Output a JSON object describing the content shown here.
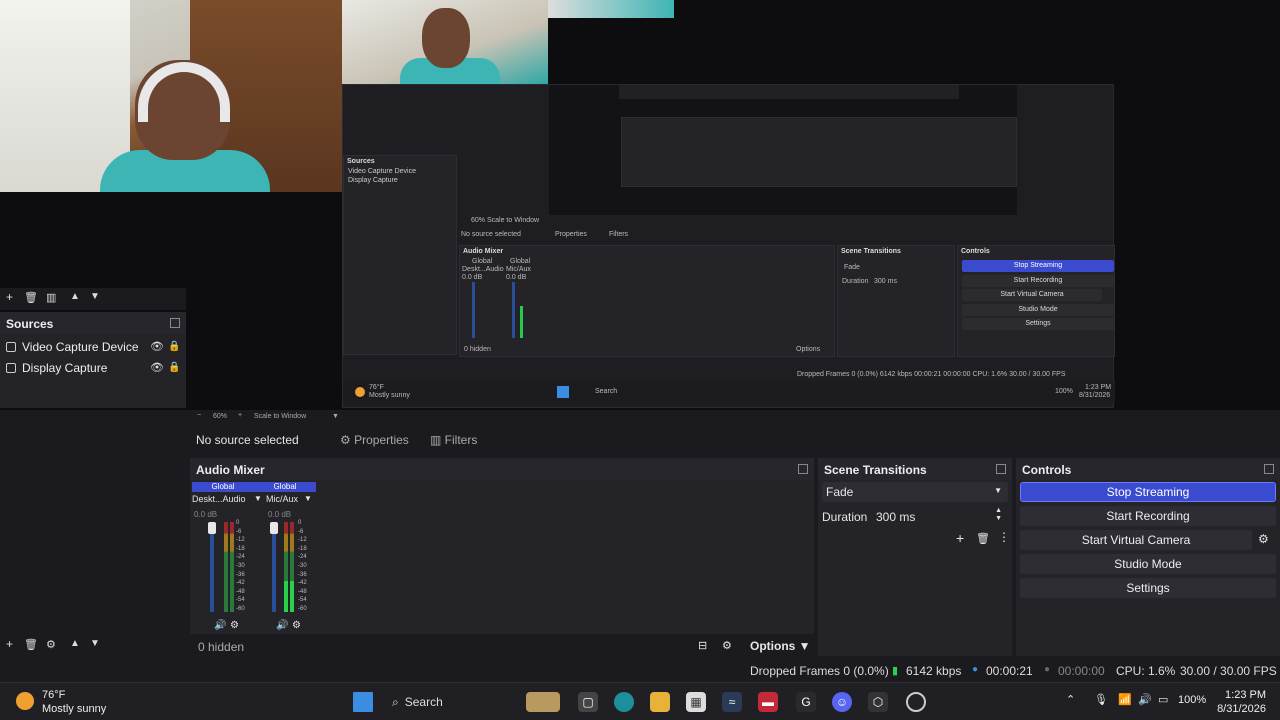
{
  "sources": {
    "title": "Sources",
    "items": [
      {
        "label": "Video Capture Device"
      },
      {
        "label": "Display Capture"
      }
    ]
  },
  "nested": {
    "sources_title": "Sources",
    "sources_items": [
      "Video Capture Device",
      "Display Capture"
    ],
    "no_source": "No source selected",
    "properties": "Properties",
    "filters": "Filters",
    "audio_mixer": "Audio Mixer",
    "scene_transitions": "Scene Transitions",
    "controls": "Controls",
    "fade": "Fade",
    "duration_label": "Duration",
    "duration_value": "300 ms",
    "stop_streaming": "Stop Streaming",
    "start_recording": "Start Recording",
    "start_virtual_camera": "Start Virtual Camera",
    "studio_mode": "Studio Mode",
    "settings": "Settings",
    "hidden": "0 hidden",
    "options": "Options",
    "status": "Dropped Frames 0 (0.0%)  6142 kbps  00:00:21  00:00:00  CPU: 1.6%  30.00 / 30.00 FPS",
    "global": "Global",
    "desk_audio": "Deskt...Audio",
    "mic_aux": "Mic/Aux",
    "db": "0.0 dB",
    "zoom": "60%",
    "scale_to_window": "Scale to Window",
    "weather_temp": "76°F",
    "weather_desc": "Mostly sunny",
    "search": "Search",
    "time": "1:23 PM",
    "date": "8/31/2026",
    "battery": "100%"
  },
  "preview_bar": {
    "zoom": "60%",
    "scale": "Scale to Window"
  },
  "properties_bar": {
    "no_source": "No source selected",
    "properties": "Properties",
    "filters": "Filters"
  },
  "audio_mixer": {
    "title": "Audio Mixer",
    "channels": [
      {
        "global": "Global",
        "name": "Deskt...Audio",
        "db": "0.0 dB",
        "level": 0.0
      },
      {
        "global": "Global",
        "name": "Mic/Aux",
        "db": "0.0 dB",
        "level": 0.35
      }
    ],
    "scale": [
      "0",
      "-6",
      "-12",
      "-18",
      "-24",
      "-30",
      "-36",
      "-42",
      "-48",
      "-54",
      "-60"
    ],
    "hidden": "0 hidden",
    "options": "Options"
  },
  "scene_transitions": {
    "title": "Scene Transitions",
    "transition": "Fade",
    "duration_label": "Duration",
    "duration_value": "300 ms"
  },
  "controls": {
    "title": "Controls",
    "stop_streaming": "Stop Streaming",
    "start_recording": "Start Recording",
    "start_virtual_camera": "Start Virtual Camera",
    "studio_mode": "Studio Mode",
    "settings": "Settings"
  },
  "status": {
    "dropped": "Dropped Frames 0 (0.0%)",
    "kbps": "6142 kbps",
    "stream_time": "00:00:21",
    "rec_time": "00:00:00",
    "cpu": "CPU: 1.6%",
    "fps": "30.00 / 30.00 FPS"
  },
  "taskbar": {
    "weather_temp": "76°F",
    "weather_desc": "Mostly sunny",
    "search": "Search",
    "battery": "100%",
    "time": "1:23 PM",
    "date": "8/31/2026"
  },
  "colors": {
    "accent": "#3a4bcf",
    "panel": "#232328",
    "bg": "#1b1b1f"
  }
}
